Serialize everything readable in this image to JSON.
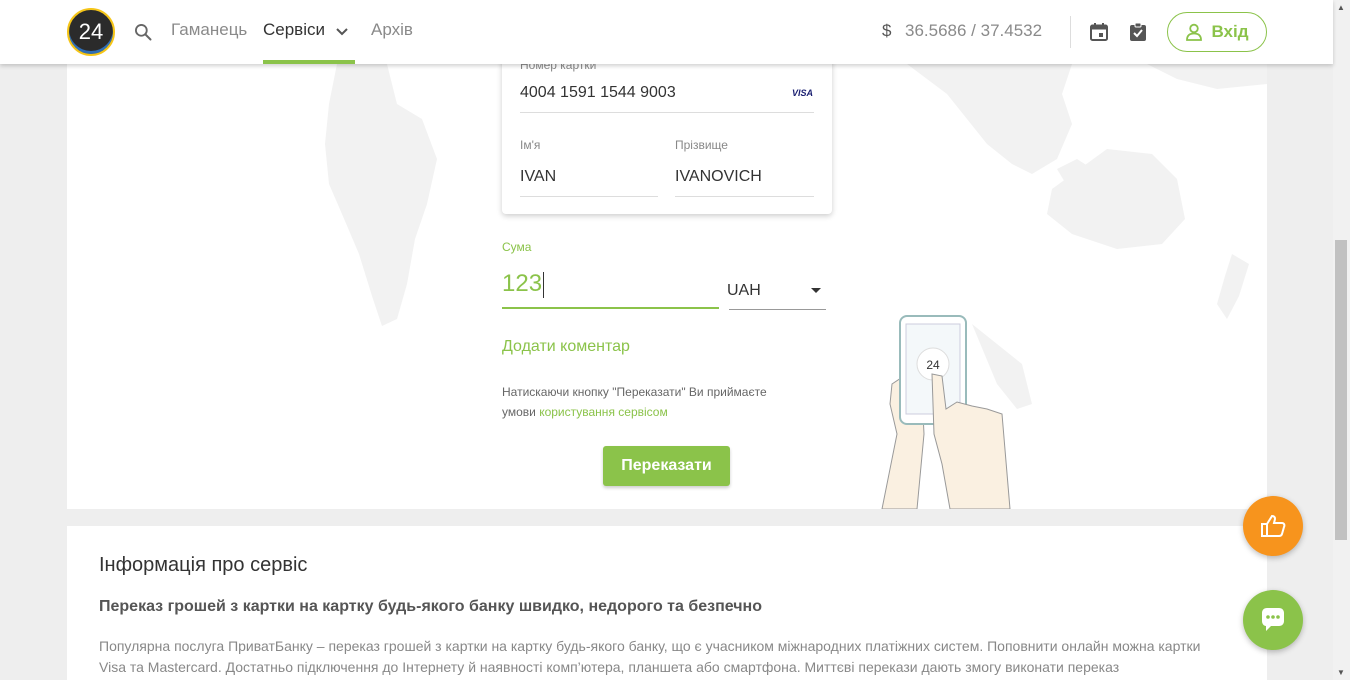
{
  "header": {
    "logo_text": "24",
    "nav": {
      "wallet": "Гаманець",
      "services": "Сервіси",
      "archive": "Архів"
    },
    "currency_symbol": "$",
    "rates": "36.5686 / 37.4532",
    "login_label": "Вхід"
  },
  "form": {
    "card_number_label": "Номер картки",
    "card_number": "4004 1591 1544 9003",
    "card_brand": "VISA",
    "name_label": "Ім'я",
    "name_value": "IVAN",
    "surname_label": "Прізвище",
    "surname_value": "IVANOVICH",
    "amount_label": "Сума",
    "amount_value": "123",
    "currency": "UAH",
    "add_comment": "Додати коментар",
    "terms_text": "Натискаючи кнопку \"Переказати\" Ви приймаєте умови ",
    "terms_link": "користування сервісом",
    "transfer_button": "Переказати",
    "illustration_badge": "24"
  },
  "info": {
    "title": "Інформація про сервіс",
    "subtitle": "Переказ грошей з картки на картку будь-якого банку швидко, недорого та безпечно",
    "text": "Популярна послуга ПриватБанку – переказ грошей з картки на картку будь-якого банку, що є учасником міжнародних платіжних систем. Поповнити онлайн можна картки Visa та Mastercard. Достатньо підключення до Інтернету й наявності комп’ютера, планшета або смартфона. Миттєві перекази дають змогу виконати переказ"
  },
  "colors": {
    "accent": "#8bc34a",
    "like_fab": "#f7941d"
  },
  "icons": [
    "search-icon",
    "chevron-down-icon",
    "dollar-icon",
    "calendar-icon",
    "clipboard-check-icon",
    "user-icon",
    "visa-logo",
    "thumbs-up-icon",
    "chat-icon"
  ]
}
